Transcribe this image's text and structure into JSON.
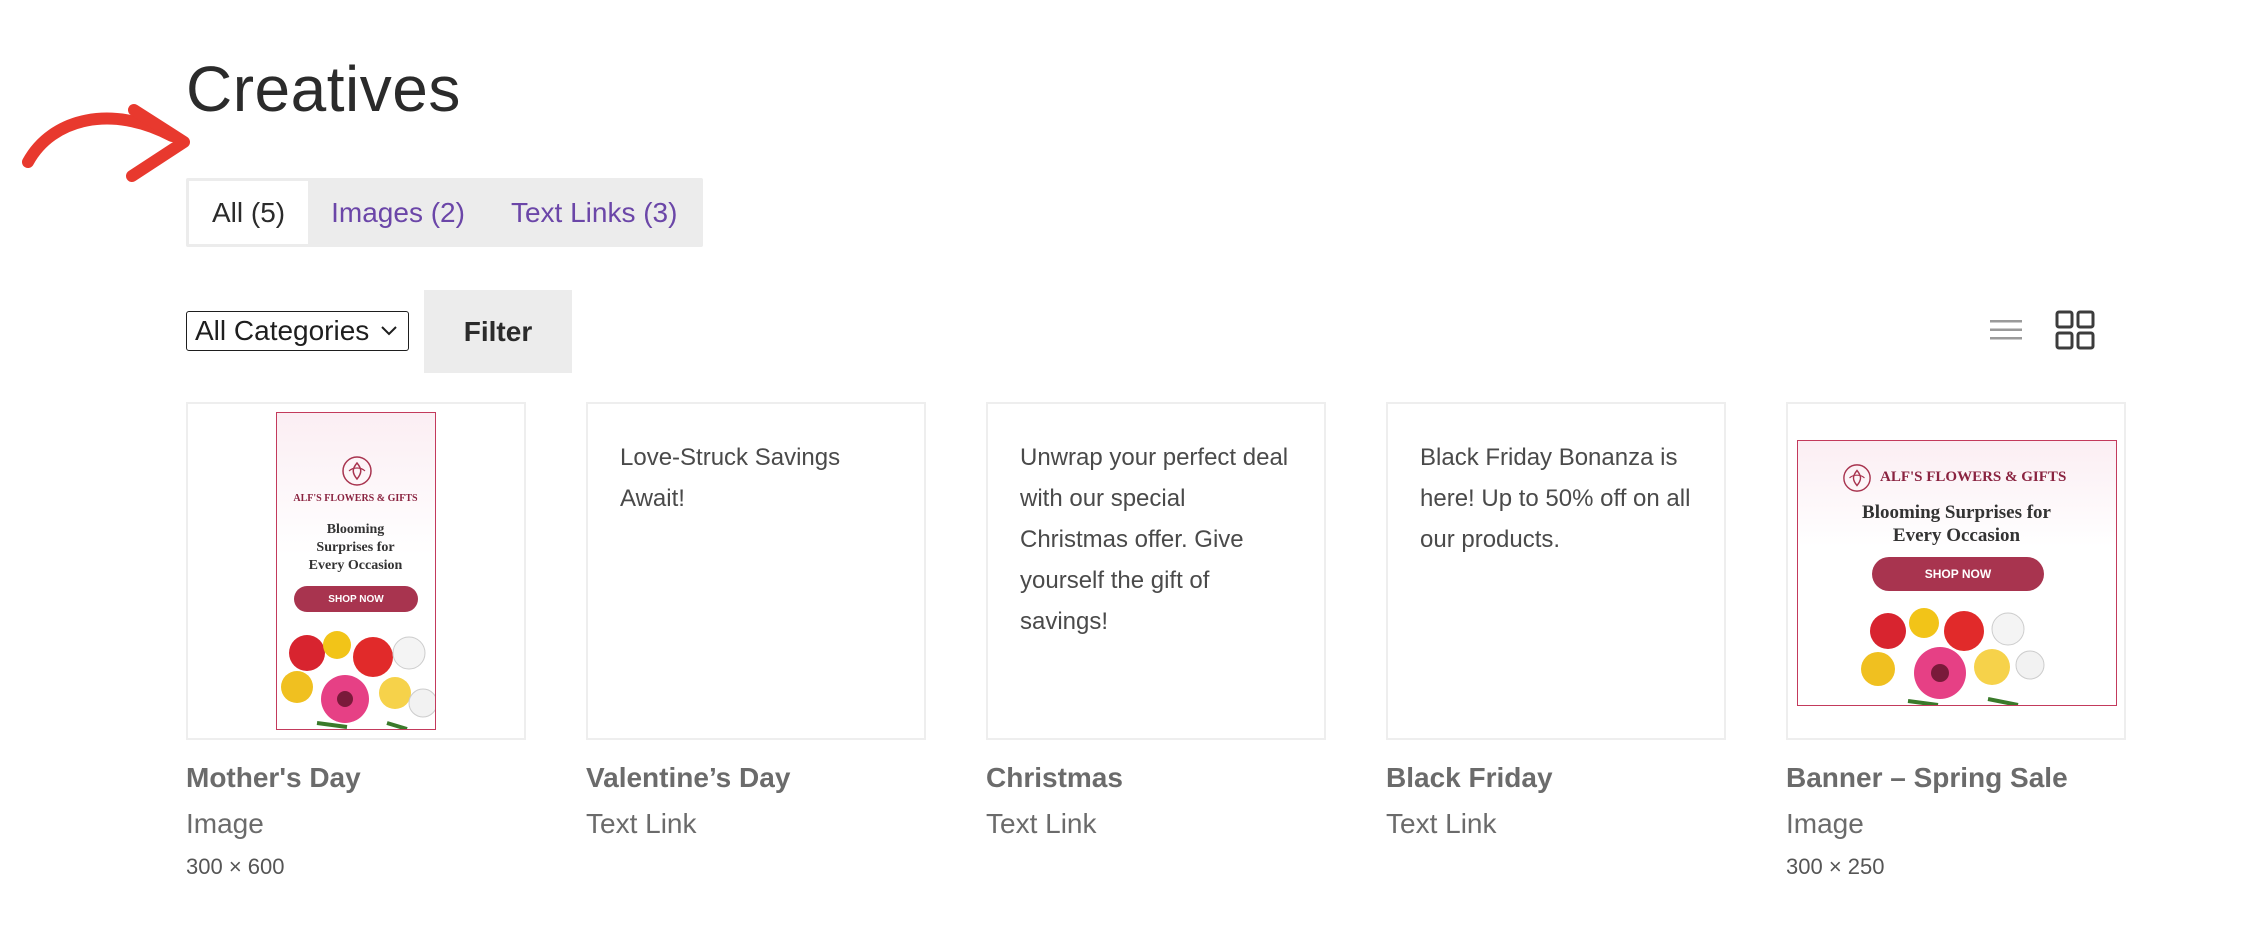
{
  "page": {
    "title": "Creatives"
  },
  "tabs": [
    {
      "label": "All (5)",
      "active": true
    },
    {
      "label": "Images (2)",
      "active": false
    },
    {
      "label": "Text Links (3)",
      "active": false
    }
  ],
  "filter": {
    "category_selected": "All Categories",
    "button_label": "Filter"
  },
  "view_toggle": {
    "list_icon": "list-view-icon",
    "grid_icon": "grid-view-icon",
    "active": "grid"
  },
  "colors": {
    "accent": "#6b46a8",
    "banner": "#a8344f",
    "annotation": "#e8392e"
  },
  "creatives": [
    {
      "name": "Mother's Day",
      "type": "Image",
      "dims": "300 × 600",
      "banner": {
        "brand": "ALF'S FLOWERS & GIFTS",
        "headline_1": "Blooming",
        "headline_2": "Surprises for",
        "headline_3": "Every Occasion",
        "cta": "SHOP NOW"
      }
    },
    {
      "name": "Valentine’s Day",
      "type": "Text Link",
      "text": "Love-Struck Savings Await!"
    },
    {
      "name": "Christmas",
      "type": "Text Link",
      "text": "Unwrap your perfect deal with our special Christmas offer. Give yourself the gift of savings!"
    },
    {
      "name": "Black Friday",
      "type": "Text Link",
      "text": "Black Friday Bonanza is here! Up to 50% off on all our products."
    },
    {
      "name": "Banner – Spring Sale",
      "type": "Image",
      "dims": "300 × 250",
      "banner": {
        "brand": "ALF'S FLOWERS & GIFTS",
        "headline_1": "Blooming Surprises for",
        "headline_2": "Every Occasion",
        "cta": "SHOP NOW"
      }
    }
  ]
}
